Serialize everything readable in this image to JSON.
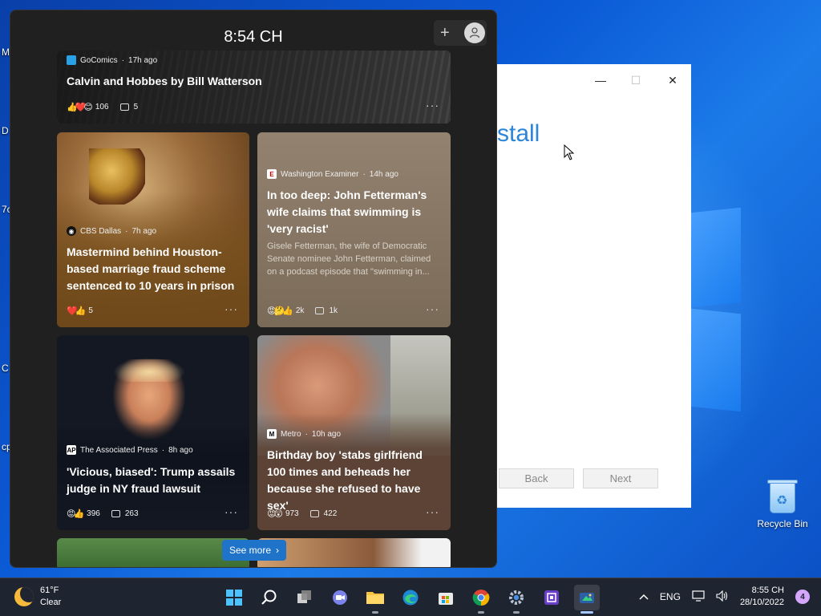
{
  "widgets": {
    "time": "8:54 CH",
    "add_label": "+",
    "see_more": "See more",
    "cards": [
      {
        "source": "GoComics",
        "age": "17h ago",
        "headline": "Calvin and Hobbes by Bill Watterson",
        "reactions": "106",
        "comments": "5",
        "more": "···"
      },
      {
        "source": "CBS Dallas",
        "age": "7h ago",
        "headline": "Mastermind behind Houston-based marriage fraud scheme sentenced to 10 years in prison",
        "reactions": "5",
        "more": "···"
      },
      {
        "source": "Washington Examiner",
        "age": "14h ago",
        "headline": "In too deep: John Fetterman's wife claims that swimming is 'very racist'",
        "summary": "Gisele Fetterman, the wife of Democratic Senate nominee John Fetterman, claimed on a podcast episode that \"swimming in...",
        "reactions": "2k",
        "comments": "1k",
        "more": "···"
      },
      {
        "source": "The Associated Press",
        "age": "8h ago",
        "headline": "'Vicious, biased': Trump assails judge in NY fraud lawsuit",
        "reactions": "396",
        "comments": "263",
        "more": "···"
      },
      {
        "source": "Metro",
        "age": "10h ago",
        "headline": "Birthday boy 'stabs girlfriend 100 times and beheads her because she refused to have sex'",
        "reactions": "973",
        "comments": "422",
        "more": "···"
      }
    ]
  },
  "installer": {
    "title_fragment": "stall",
    "back": "Back",
    "next": "Next",
    "minimize": "—",
    "maximize": "☐",
    "close": "✕"
  },
  "desktop": {
    "recycle_bin": "Recycle Bin",
    "edge_labels": [
      "M",
      "D",
      "7c",
      "C",
      "cp"
    ]
  },
  "taskbar": {
    "temperature": "61°F",
    "condition": "Clear",
    "language": "ENG",
    "time": "8:55 CH",
    "date": "28/10/2022",
    "notifications": "4",
    "icons": [
      "start-icon",
      "search-icon",
      "task-view-icon",
      "chat-icon",
      "file-explorer-icon",
      "edge-icon",
      "store-icon",
      "chrome-icon",
      "settings-icon",
      "chip-app-icon",
      "snipping-icon"
    ]
  },
  "colors": {
    "accent": "#1f73c9",
    "panel_bg": "#202020",
    "taskbar_bg": "#1e2430"
  }
}
